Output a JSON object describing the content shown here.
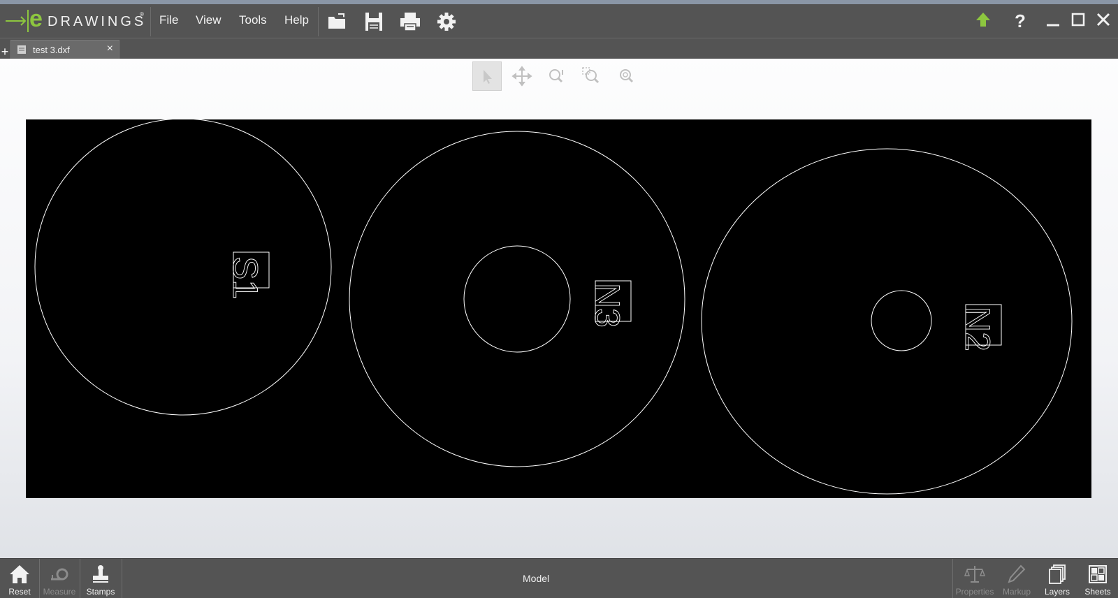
{
  "app": {
    "logo_letter": "e",
    "logo_text": "DRAWINGS",
    "logo_mark": "®"
  },
  "menu": {
    "items": [
      "File",
      "View",
      "Tools",
      "Help"
    ]
  },
  "toolbar": {
    "icons": [
      "open-icon",
      "save-icon",
      "print-icon",
      "settings-icon"
    ]
  },
  "window_controls": {
    "icons": [
      "update-icon",
      "help-icon",
      "minimize-icon",
      "maximize-icon",
      "close-icon"
    ]
  },
  "tab": {
    "label": "test 3.dxf",
    "close": "×",
    "add": "+"
  },
  "view_tools": [
    "select-icon",
    "pan-icon",
    "zoom-icon",
    "zoom-area-icon",
    "zoom-fit-icon"
  ],
  "drawing": {
    "background": "#000000",
    "stroke": "#ffffff",
    "labels": [
      "S1",
      "N3",
      "N2"
    ]
  },
  "bottom": {
    "left_buttons": [
      {
        "label": "Reset",
        "enabled": true
      },
      {
        "label": "Measure",
        "enabled": false
      },
      {
        "label": "Stamps",
        "enabled": true
      }
    ],
    "center": "Model",
    "right_buttons": [
      {
        "label": "Properties",
        "enabled": false
      },
      {
        "label": "Markup",
        "enabled": false
      },
      {
        "label": "Layers",
        "enabled": true
      },
      {
        "label": "Sheets",
        "enabled": true
      }
    ]
  },
  "colors": {
    "chrome": "#545454",
    "logo_green": "#8dc63f",
    "update_green": "#8dc63f"
  }
}
